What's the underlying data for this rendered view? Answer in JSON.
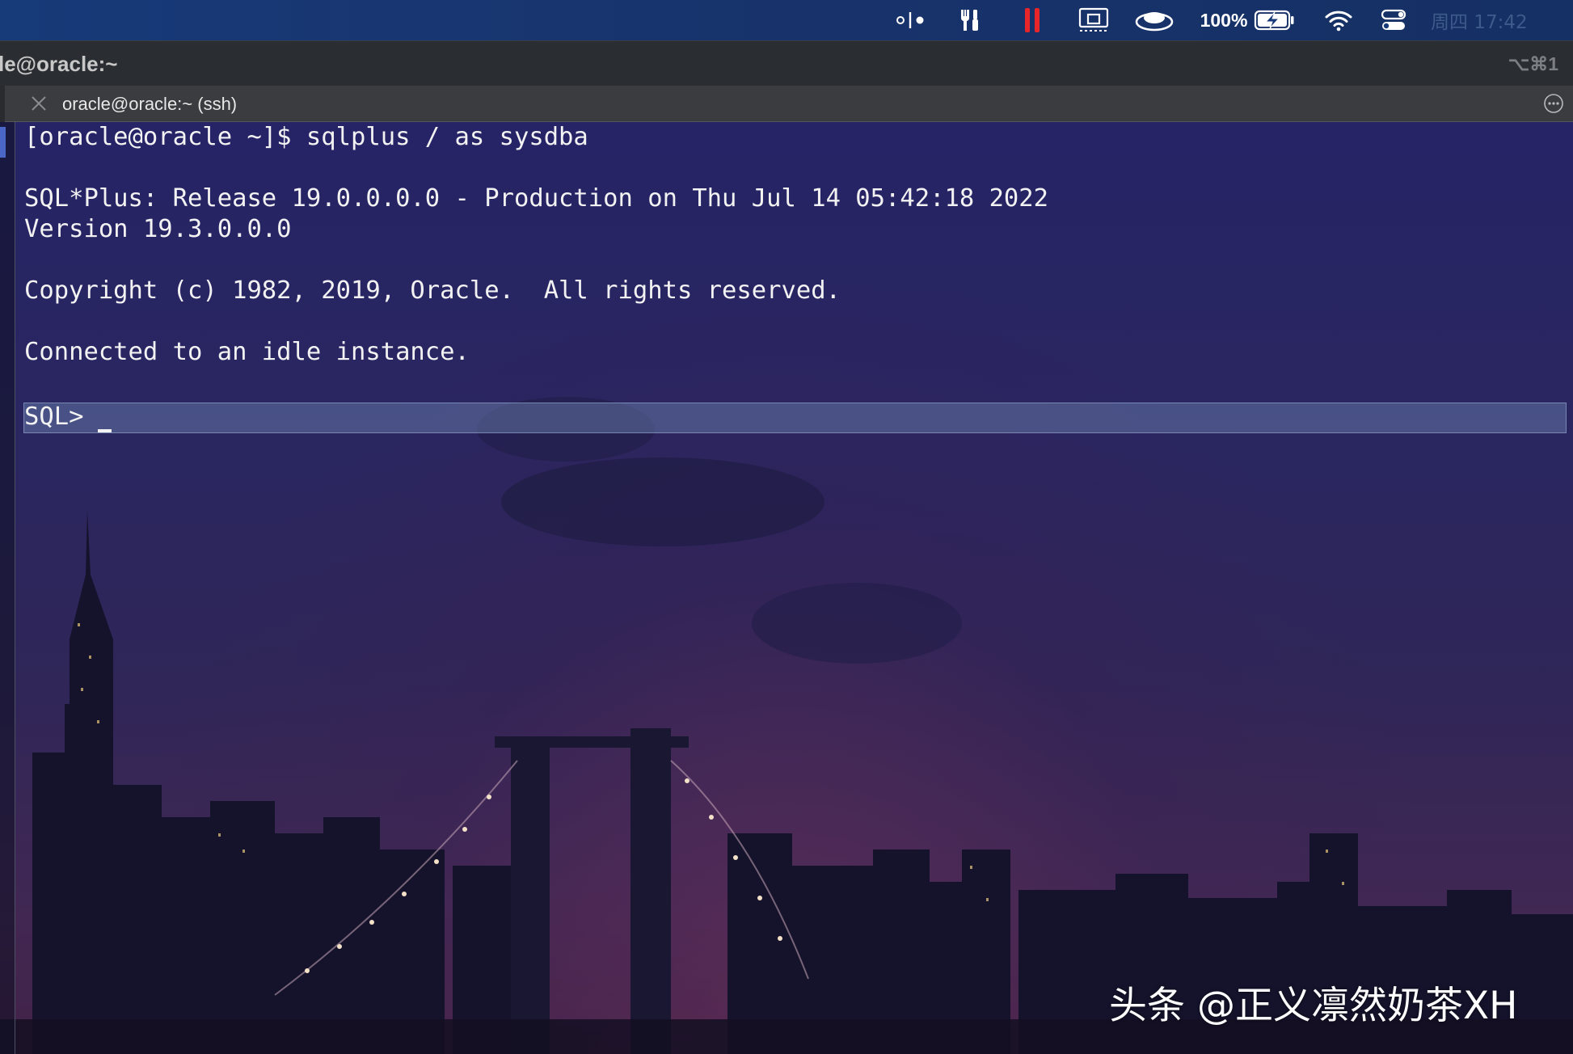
{
  "menubar": {
    "icons": [
      "hand-off-icon",
      "tools-icon",
      "recording-pause-icon",
      "screen-mirroring-icon",
      "hat-icon",
      "battery-charging-icon",
      "wifi-icon",
      "control-center-icon"
    ],
    "battery_percent": "100%",
    "clock": "周四 17:42"
  },
  "window": {
    "title": "le@oracle:~",
    "shortcut": "⌥⌘1"
  },
  "tab": {
    "label": "oracle@oracle:~ (ssh)"
  },
  "terminal": {
    "lines": [
      "[oracle@oracle ~]$ sqlplus / as sysdba",
      "",
      "SQL*Plus: Release 19.0.0.0.0 - Production on Thu Jul 14 05:42:18 2022",
      "Version 19.3.0.0.0",
      "",
      "Copyright (c) 1982, 2019, Oracle.  All rights reserved.",
      "",
      "Connected to an idle instance.",
      "",
      "SQL> "
    ],
    "prompt": "SQL> "
  },
  "watermark": "头条 @正义凛然奶茶XH",
  "colors": {
    "menubar": "#173a78",
    "titlebar": "#2a2d31",
    "tabbar": "#3b3c3f",
    "terminal_bg": "#262466",
    "terminal_text": "#f2f2f2",
    "recording": "#e8262a",
    "gutter_mark": "#4a67c8"
  }
}
